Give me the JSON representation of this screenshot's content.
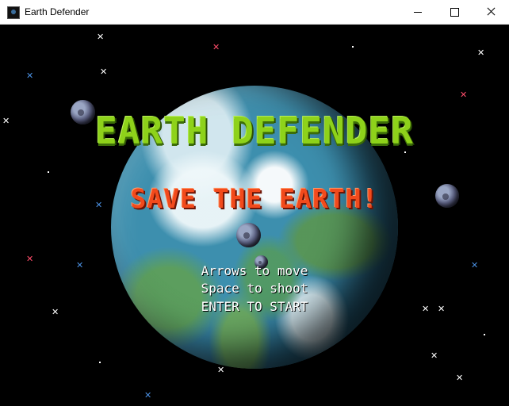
{
  "window": {
    "title": "Earth Defender"
  },
  "game": {
    "title": "EARTH DEFENDER",
    "subtitle": "SAVE THE EARTH!",
    "instructions": [
      "Arrows to move",
      "Space to shoot",
      "ENTER TO START"
    ]
  },
  "colors": {
    "title": "#8ed21a",
    "subtitle": "#f24a1c",
    "instructions": "#ffffff",
    "background": "#000000"
  },
  "icons": {
    "app": "app-icon",
    "minimize": "minimize-icon",
    "maximize": "maximize-icon",
    "close": "close-icon"
  }
}
